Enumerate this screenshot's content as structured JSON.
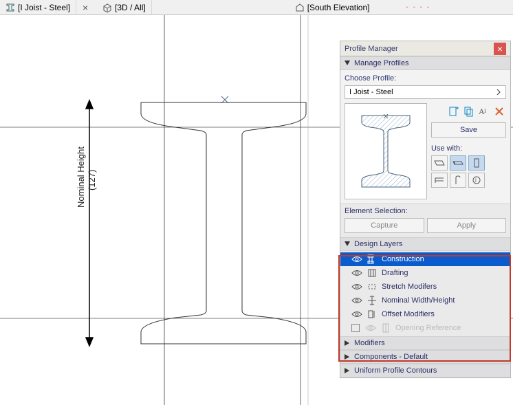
{
  "tabs": [
    {
      "label": "[I Joist - Steel]",
      "icon": "profile-icon",
      "active": true
    },
    {
      "label": "[3D / All]",
      "icon": "cube-icon",
      "active": false
    },
    {
      "label": "[South Elevation]",
      "icon": "elevation-icon",
      "active": false
    }
  ],
  "dimension": {
    "label": "Nominal Height",
    "value": "(127)"
  },
  "panel": {
    "title": "Profile Manager",
    "manage_profiles": "Manage Profiles",
    "choose_profile_label": "Choose Profile:",
    "profile_name": "I Joist - Steel",
    "save_label": "Save",
    "use_with_label": "Use with:",
    "element_selection_label": "Element Selection:",
    "capture_label": "Capture",
    "apply_label": "Apply",
    "design_layers_label": "Design Layers",
    "layers": [
      {
        "name": "Construction",
        "selected": true,
        "disabled": false
      },
      {
        "name": "Drafting",
        "selected": false,
        "disabled": false
      },
      {
        "name": "Stretch Modifers",
        "selected": false,
        "disabled": false
      },
      {
        "name": "Nominal Width/Height",
        "selected": false,
        "disabled": false
      },
      {
        "name": "Offset Modifiers",
        "selected": false,
        "disabled": false
      },
      {
        "name": "Opening Reference",
        "selected": false,
        "disabled": true
      }
    ],
    "modifiers_label": "Modifiers",
    "components_label": "Components - Default",
    "contours_label": "Uniform Profile Contours"
  }
}
